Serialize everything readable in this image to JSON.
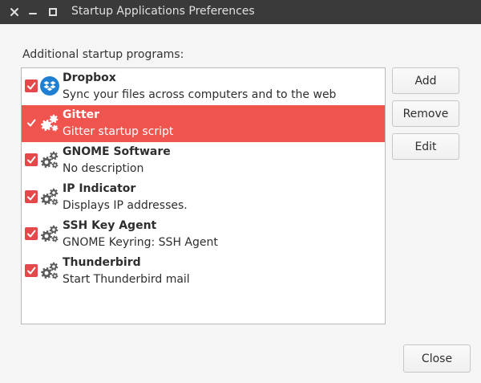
{
  "window": {
    "title": "Startup Applications Preferences",
    "controls": {
      "close_icon": "close-icon",
      "minimize_icon": "minimize-icon",
      "maximize_icon": "maximize-icon"
    }
  },
  "list_label": "Additional startup programs:",
  "programs": [
    {
      "name": "Dropbox",
      "description": "Sync your files across computers and to the web",
      "enabled": true,
      "selected": false,
      "icon": "dropbox-icon"
    },
    {
      "name": "Gitter",
      "description": "Gitter startup script",
      "enabled": true,
      "selected": true,
      "icon": "gears-icon"
    },
    {
      "name": "GNOME Software",
      "description": "No description",
      "enabled": true,
      "selected": false,
      "icon": "gears-icon"
    },
    {
      "name": "IP Indicator",
      "description": "Displays IP addresses.",
      "enabled": true,
      "selected": false,
      "icon": "gears-icon"
    },
    {
      "name": "SSH Key Agent",
      "description": "GNOME Keyring: SSH Agent",
      "enabled": true,
      "selected": false,
      "icon": "gears-icon"
    },
    {
      "name": "Thunderbird",
      "description": "Start Thunderbird mail",
      "enabled": true,
      "selected": false,
      "icon": "gears-icon"
    }
  ],
  "buttons": {
    "add": "Add",
    "remove": "Remove",
    "edit": "Edit",
    "close": "Close"
  },
  "colors": {
    "titlebar": "#3a3a3a",
    "accent": "#f0544f",
    "checkbox": "#e5474a",
    "background": "#f5f5f5"
  }
}
